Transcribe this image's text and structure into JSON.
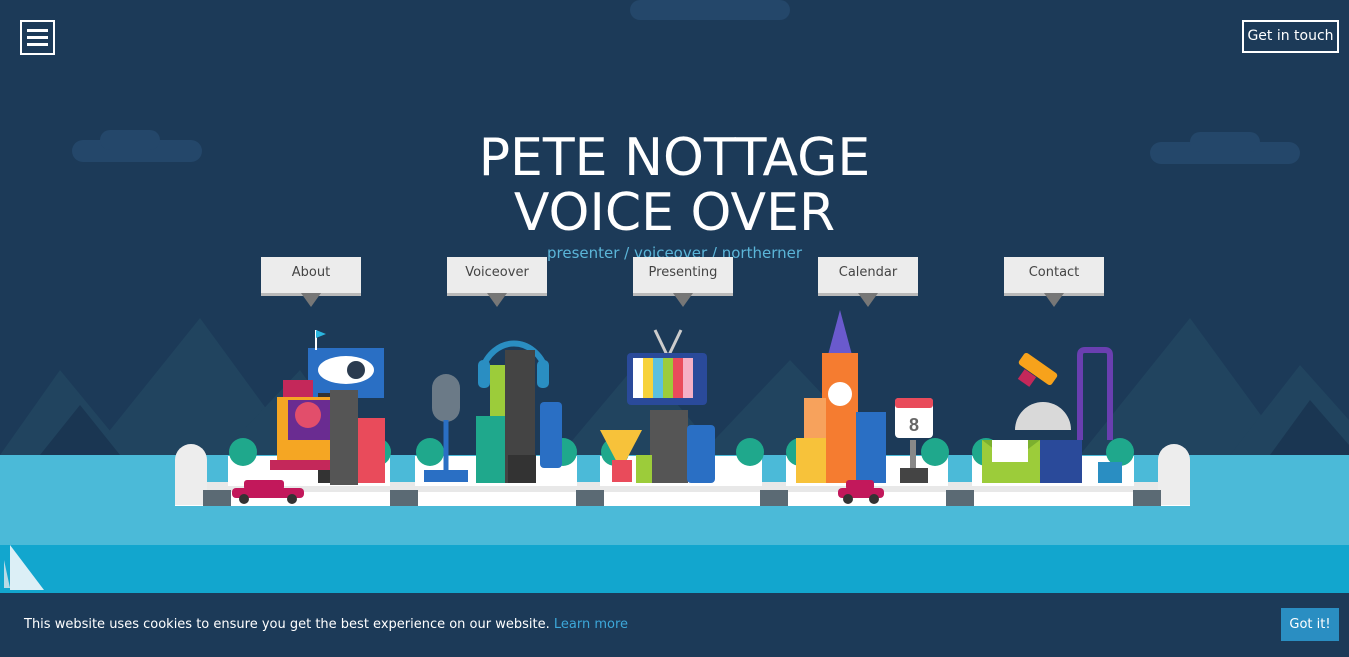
{
  "header": {
    "menu_icon": "hamburger-menu-icon",
    "cta_label": "Get in touch"
  },
  "hero": {
    "title_line1": "PETE NOTTAGE",
    "title_line2": "VOICE OVER",
    "subtitle": "presenter / voiceover / northerner"
  },
  "nav": {
    "items": [
      {
        "label": "About"
      },
      {
        "label": "Voiceover"
      },
      {
        "label": "Presenting"
      },
      {
        "label": "Calendar"
      },
      {
        "label": "Contact"
      }
    ]
  },
  "calendar_widget": {
    "day": "8"
  },
  "cookie": {
    "message": "This website uses cookies to ensure you get the best experience on our website.",
    "link_label": "Learn more",
    "button_label": "Got it!"
  },
  "colors": {
    "background": "#1c3a58",
    "water": "#4bbad8",
    "accent": "#2a8ec2"
  }
}
